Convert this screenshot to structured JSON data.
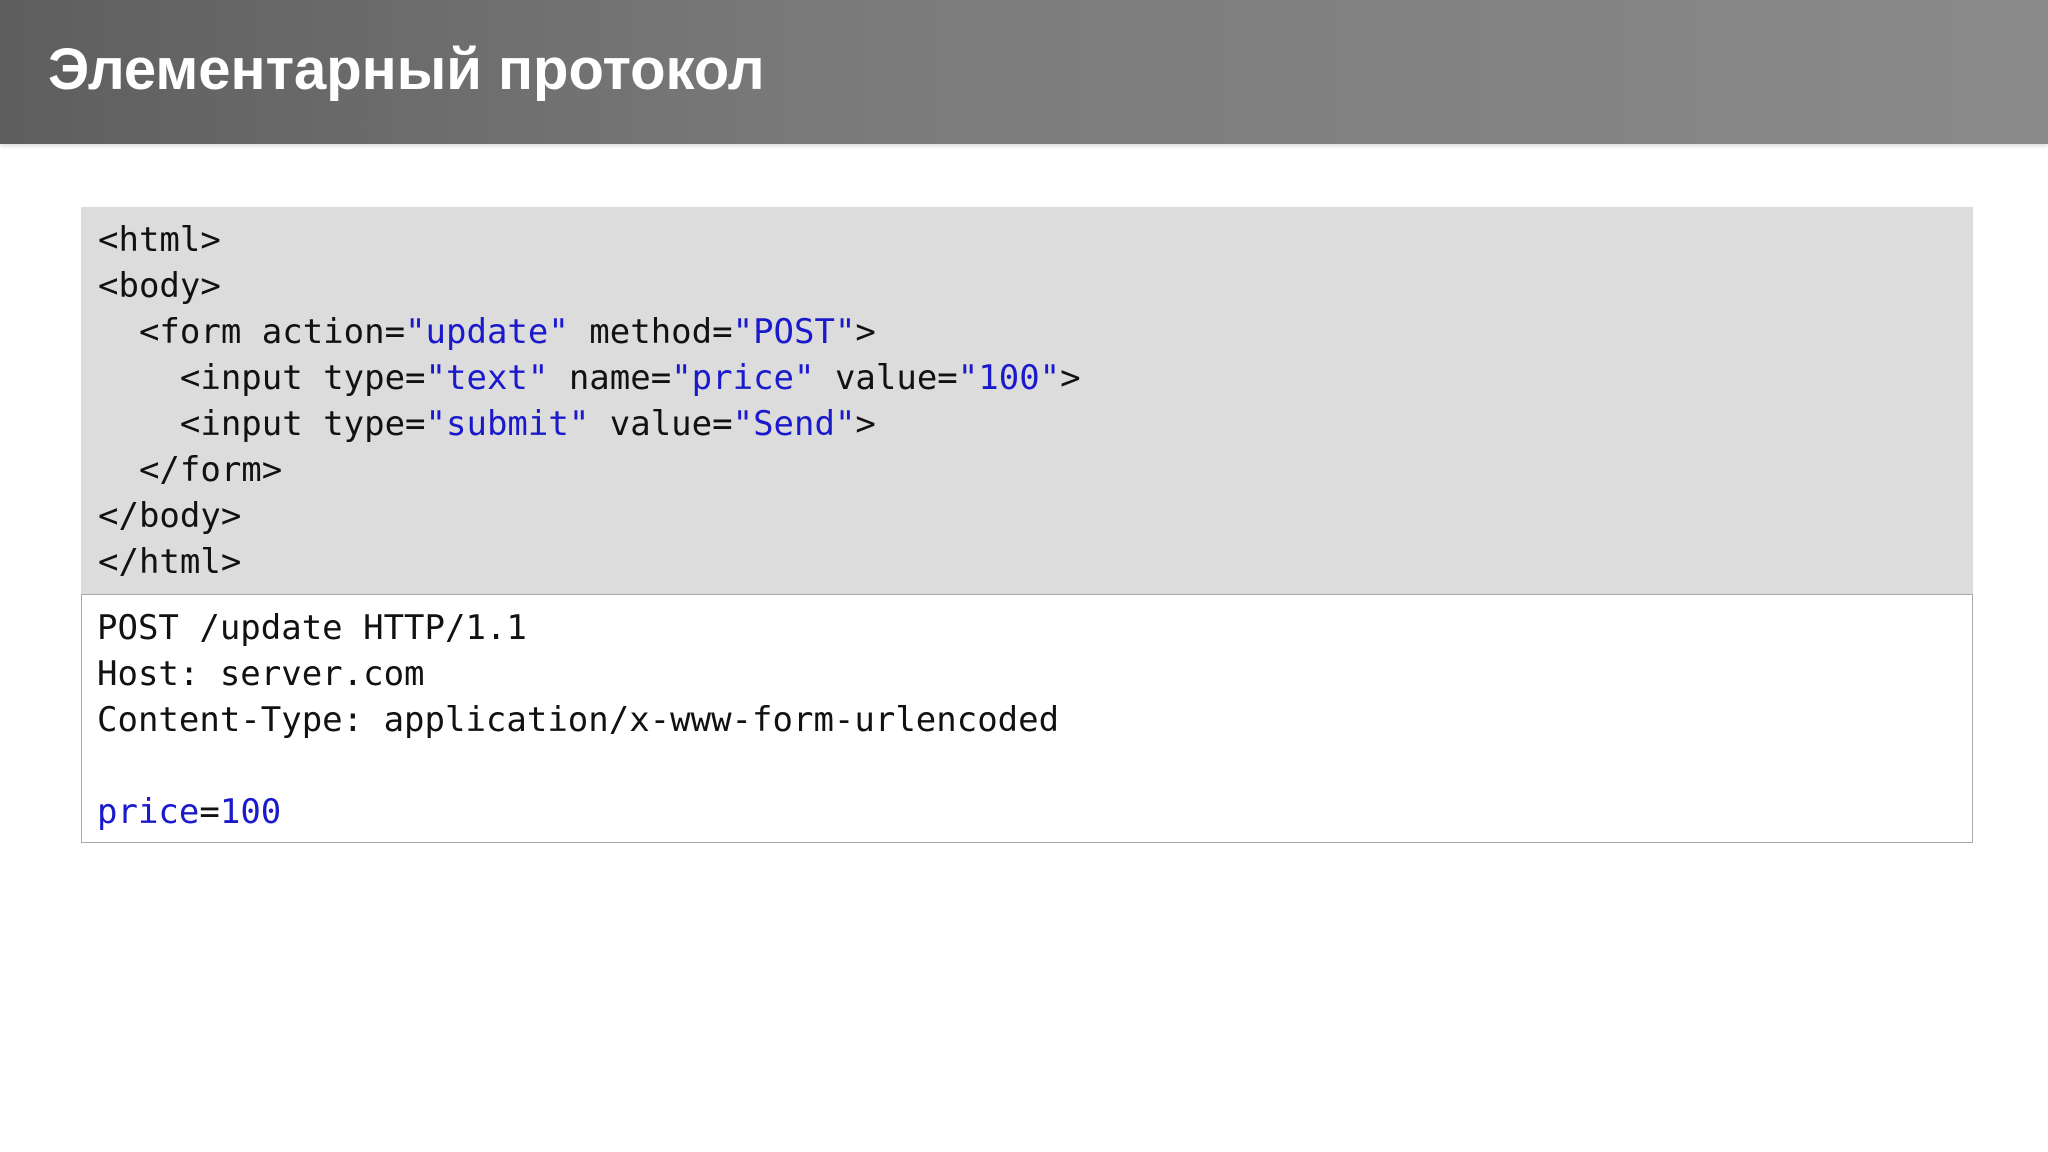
{
  "title": "Элементарный протокол",
  "html_code": {
    "lines": [
      {
        "indent": "",
        "parts": [
          {
            "t": "<html>",
            "s": false
          }
        ]
      },
      {
        "indent": "",
        "parts": [
          {
            "t": "<body>",
            "s": false
          }
        ]
      },
      {
        "indent": "  ",
        "parts": [
          {
            "t": "<form action=",
            "s": false
          },
          {
            "t": "\"update\"",
            "s": true
          },
          {
            "t": " method=",
            "s": false
          },
          {
            "t": "\"POST\"",
            "s": true
          },
          {
            "t": ">",
            "s": false
          }
        ]
      },
      {
        "indent": "    ",
        "parts": [
          {
            "t": "<input type=",
            "s": false
          },
          {
            "t": "\"text\"",
            "s": true
          },
          {
            "t": " name=",
            "s": false
          },
          {
            "t": "\"price\"",
            "s": true
          },
          {
            "t": " value=",
            "s": false
          },
          {
            "t": "\"100\"",
            "s": true
          },
          {
            "t": ">",
            "s": false
          }
        ]
      },
      {
        "indent": "    ",
        "parts": [
          {
            "t": "<input type=",
            "s": false
          },
          {
            "t": "\"submit\"",
            "s": true
          },
          {
            "t": " value=",
            "s": false
          },
          {
            "t": "\"Send\"",
            "s": true
          },
          {
            "t": ">",
            "s": false
          }
        ]
      },
      {
        "indent": "  ",
        "parts": [
          {
            "t": "</form>",
            "s": false
          }
        ]
      },
      {
        "indent": "",
        "parts": [
          {
            "t": "</body>",
            "s": false
          }
        ]
      },
      {
        "indent": "",
        "parts": [
          {
            "t": "</html>",
            "s": false
          }
        ]
      }
    ]
  },
  "http_request": {
    "lines": [
      {
        "indent": "",
        "parts": [
          {
            "t": "POST /update HTTP/1.1",
            "s": false
          }
        ]
      },
      {
        "indent": "",
        "parts": [
          {
            "t": "Host: server.com",
            "s": false
          }
        ]
      },
      {
        "indent": "",
        "parts": [
          {
            "t": "Content-Type: application/x-www-form-urlencoded",
            "s": false
          }
        ]
      },
      {
        "indent": "",
        "parts": []
      },
      {
        "indent": "",
        "parts": [
          {
            "t": "price",
            "s": true
          },
          {
            "t": "=",
            "s": false
          },
          {
            "t": "100",
            "s": true
          }
        ]
      }
    ]
  },
  "colors": {
    "title_bar": "#707070",
    "title_text": "#ffffff",
    "code_background": "#dcdcdc",
    "string_highlight": "#1a1acc",
    "request_border": "#a9a9a9"
  }
}
